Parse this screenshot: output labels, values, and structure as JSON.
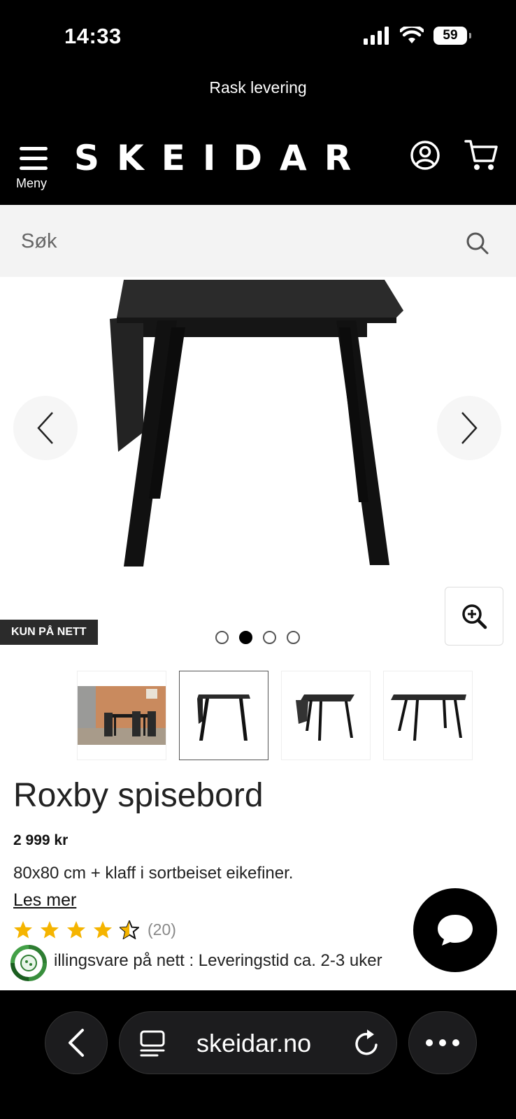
{
  "status_bar": {
    "time": "14:33",
    "battery": "59"
  },
  "promo": {
    "text": "Rask levering"
  },
  "header": {
    "logo": "SKEIDAR",
    "menu_label": "Meny"
  },
  "search": {
    "placeholder": "Søk"
  },
  "gallery": {
    "badge": "KUN PÅ NETT",
    "dots_count": 4,
    "active_dot": 1,
    "thumbnails_count": 4,
    "selected_thumbnail": 1
  },
  "product": {
    "title": "Roxby spisebord",
    "price": "2 999 kr",
    "description": "80x80 cm + klaff i sortbeiset eikefiner.",
    "read_more": "Les mer",
    "rating": {
      "stars": 4.5,
      "count": "(20)"
    },
    "availability": "illingsvare på nett : Leveringstid ca. 2-3 uker"
  },
  "browser": {
    "url": "skeidar.no"
  },
  "colors": {
    "brand_black": "#000000",
    "star": "#f5b400",
    "eco_green": "#2e7d32"
  }
}
